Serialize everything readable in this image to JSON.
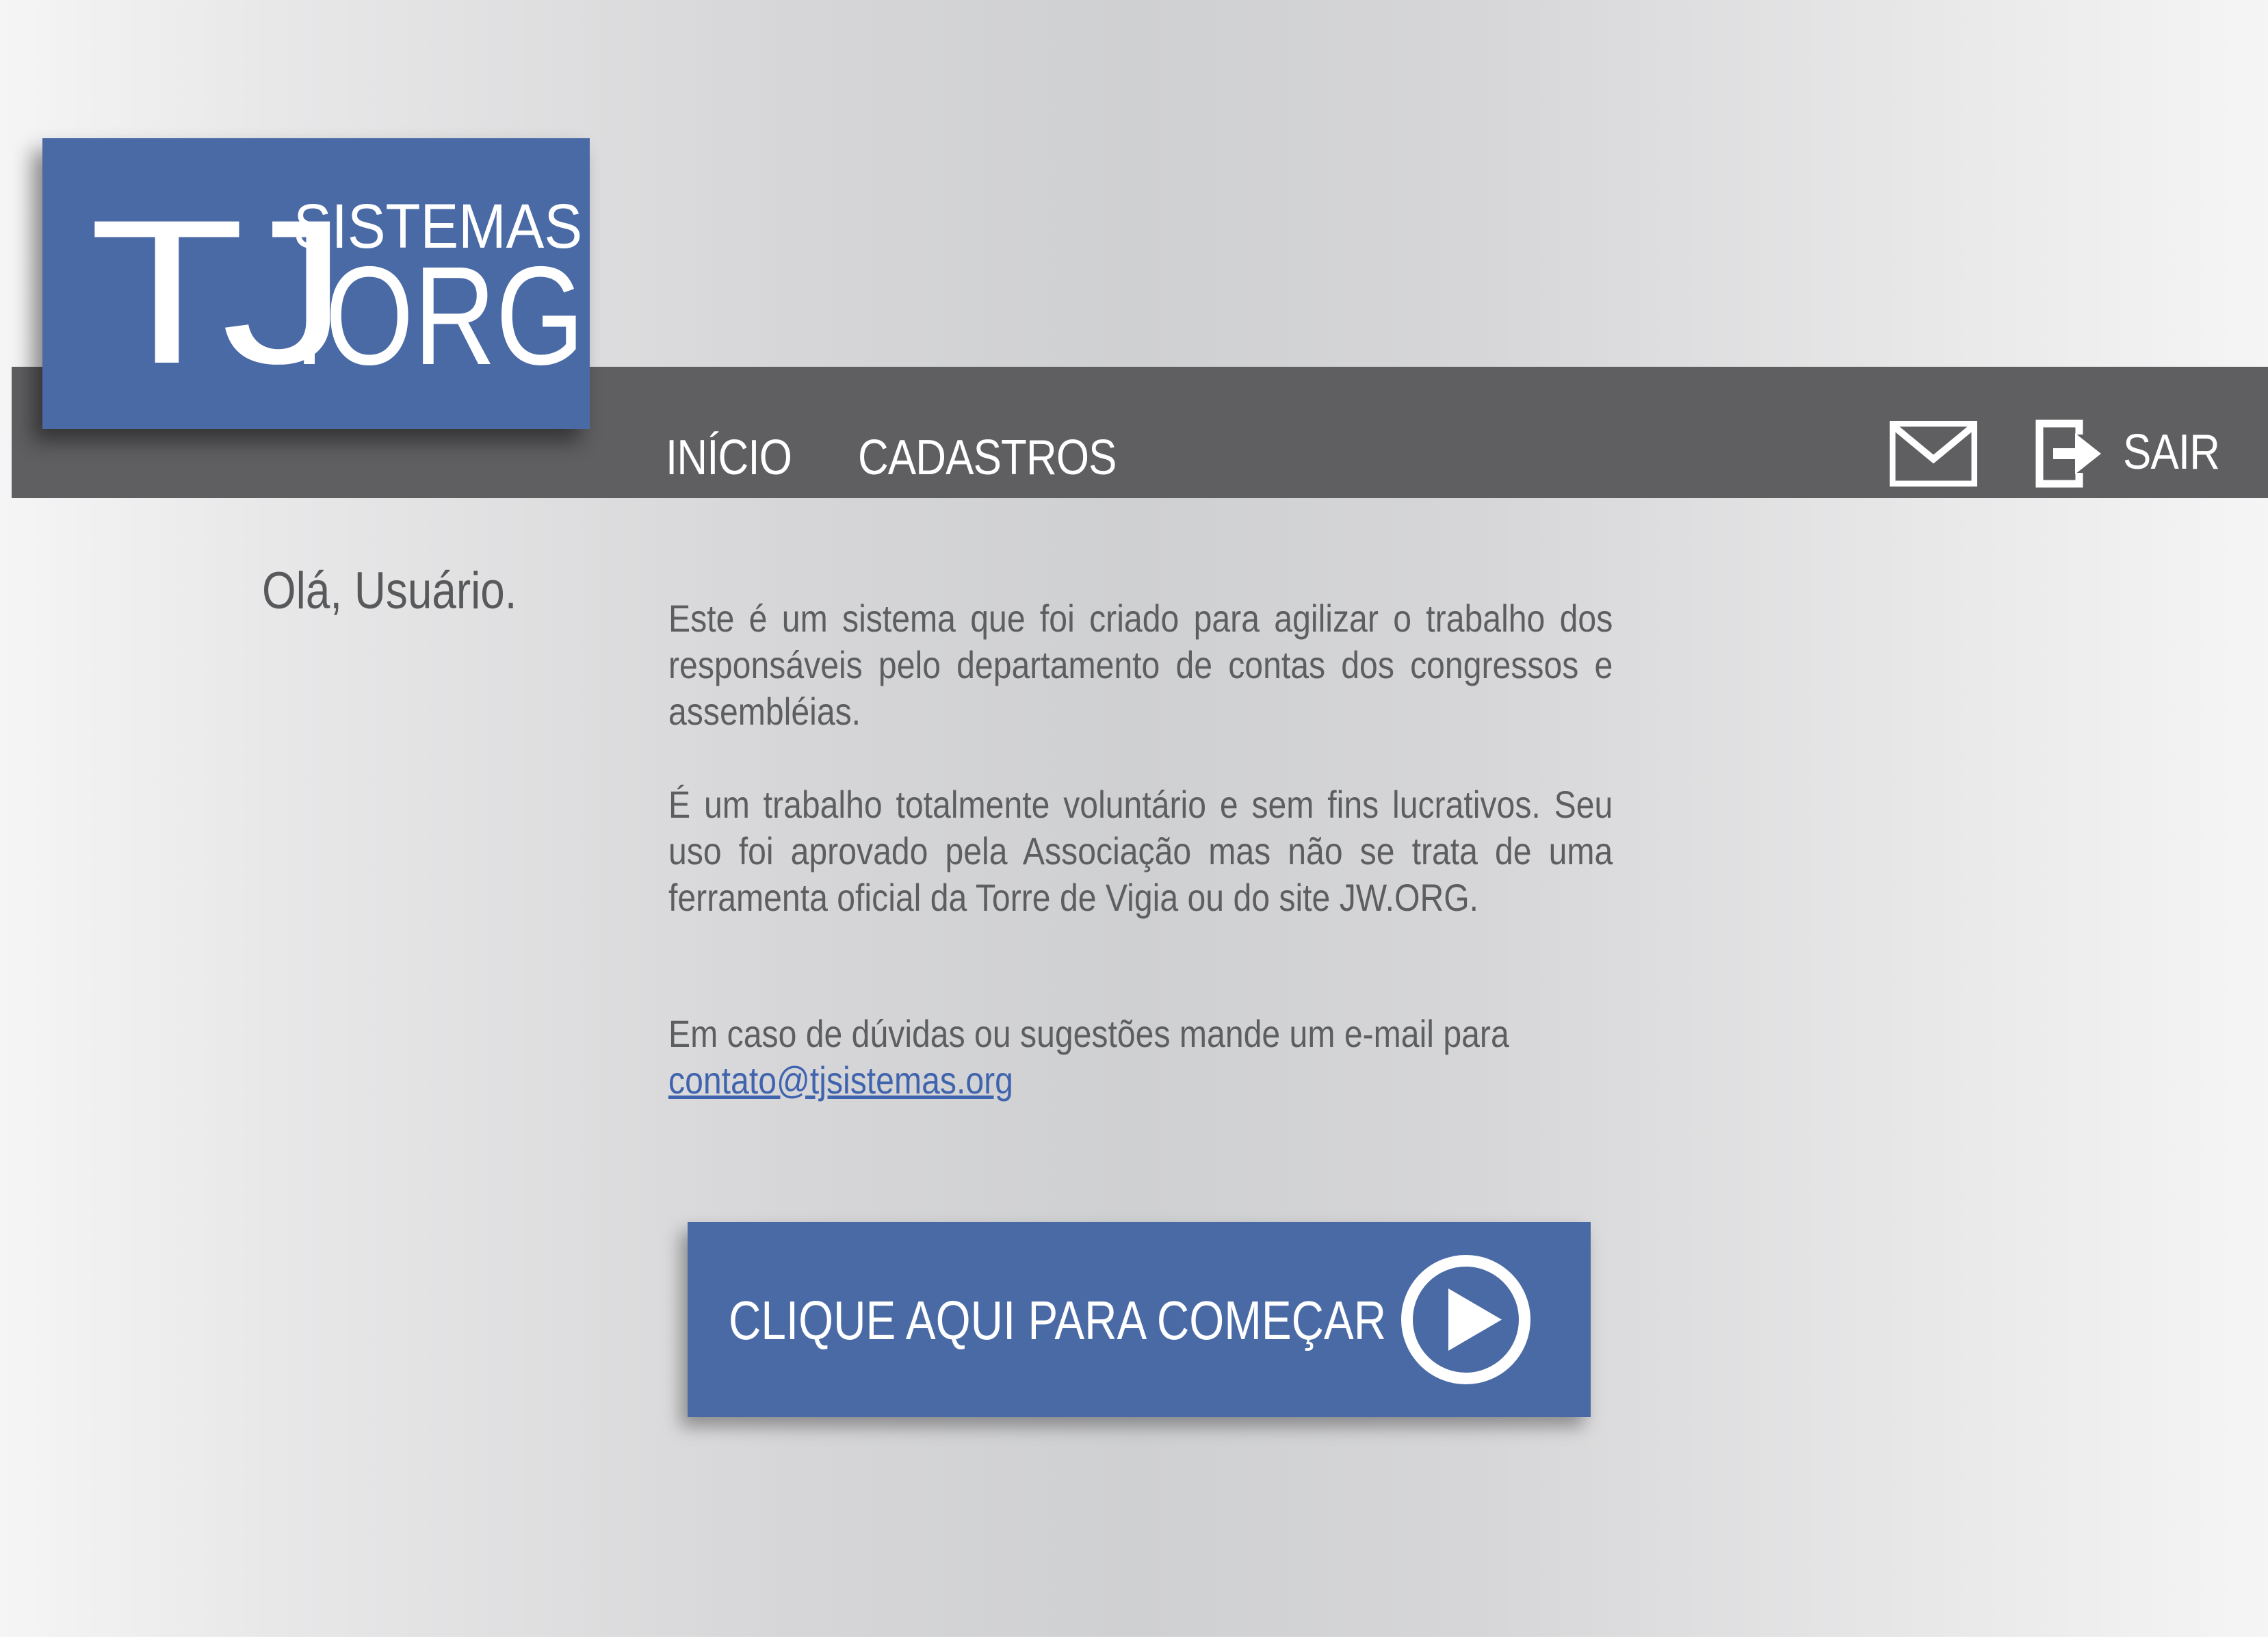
{
  "logo": {
    "tj": "TJ",
    "sistemas": "SISTEMAS",
    "org": ".ORG"
  },
  "nav": {
    "inicio": "INÍCIO",
    "cadastros": "CADASTROS",
    "sair": "SAIR",
    "mail_icon": "envelope-icon",
    "logout_icon": "logout-arrow-icon"
  },
  "greeting": "Olá, Usuário.",
  "content": {
    "paragraph1": "Este é um sistema que foi criado para agilizar o trabalho dos responsáveis pelo departamento de contas dos congressos e assembléias.",
    "paragraph2": "É um trabalho totalmente voluntário e sem fins lucrativos. Seu uso foi aprovado pela Associação mas não se trata de uma ferramenta oficial da Torre de Vigia ou do site JW.ORG.",
    "paragraph3": "Em caso de dúvidas ou sugestões mande um e-mail para",
    "email": "contato@tjsistemas.org"
  },
  "cta": {
    "label": "CLIQUE AQUI PARA COMEÇAR",
    "icon": "play-circle-icon"
  },
  "colors": {
    "brand_blue": "#4a6aa6",
    "nav_gray": "#5f5f61",
    "text_gray": "#5d5e60",
    "link_blue": "#3f64ad"
  }
}
